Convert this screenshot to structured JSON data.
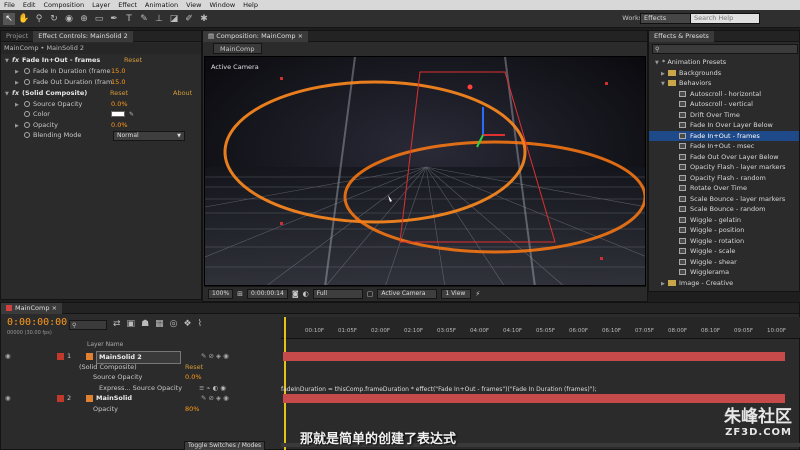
{
  "menu": [
    "File",
    "Edit",
    "Composition",
    "Layer",
    "Effect",
    "Animation",
    "View",
    "Window",
    "Help"
  ],
  "toolbar": {
    "workspace_label": "Workspace:",
    "workspace_value": "Effects",
    "search_placeholder": "Search Help"
  },
  "left_panel": {
    "tabs": [
      "Project",
      "Effect Controls: MainSolid 2"
    ],
    "breadcrumb": "MainComp • MainSolid 2",
    "effect1": {
      "name": "Fade In+Out - frames",
      "reset": "Reset"
    },
    "props1": [
      {
        "label": "Fade In Duration (frame",
        "value": "15.0"
      },
      {
        "label": "Fade Out Duration (fram",
        "value": "15.0"
      }
    ],
    "effect2": {
      "name": "(Solid Composite)",
      "reset": "Reset",
      "about": "About"
    },
    "props2": [
      {
        "label": "Source Opacity",
        "value": "0.0%"
      },
      {
        "label": "Color",
        "value": ""
      },
      {
        "label": "Opacity",
        "value": "0.0%"
      },
      {
        "label": "Blending Mode",
        "value": "Normal"
      }
    ]
  },
  "comp": {
    "tab": "Composition: MainComp",
    "subtab": "MainComp",
    "camera_label": "Active Camera",
    "zoom": "100%",
    "timecode": "0:00:00:14",
    "resolution": "Full",
    "view": "Active Camera",
    "views": "1 View"
  },
  "right_panel": {
    "tab": "Effects & Presets",
    "items": [
      {
        "label": "* Animation Presets",
        "kind": "root"
      },
      {
        "label": "Backgrounds",
        "kind": "folder"
      },
      {
        "label": "Behaviors",
        "kind": "folder-open"
      },
      {
        "label": "Autoscroll - horizontal",
        "kind": "preset"
      },
      {
        "label": "Autoscroll - vertical",
        "kind": "preset"
      },
      {
        "label": "Drift Over Time",
        "kind": "preset"
      },
      {
        "label": "Fade In Over Layer Below",
        "kind": "preset"
      },
      {
        "label": "Fade In+Out - frames",
        "kind": "preset-selected"
      },
      {
        "label": "Fade In+Out - msec",
        "kind": "preset"
      },
      {
        "label": "Fade Out Over Layer Below",
        "kind": "preset"
      },
      {
        "label": "Opacity Flash - layer markers",
        "kind": "preset"
      },
      {
        "label": "Opacity Flash - random",
        "kind": "preset"
      },
      {
        "label": "Rotate Over Time",
        "kind": "preset"
      },
      {
        "label": "Scale Bounce - layer markers",
        "kind": "preset"
      },
      {
        "label": "Scale Bounce - random",
        "kind": "preset"
      },
      {
        "label": "Wiggle - gelatin",
        "kind": "preset"
      },
      {
        "label": "Wiggle - position",
        "kind": "preset"
      },
      {
        "label": "Wiggle - rotation",
        "kind": "preset"
      },
      {
        "label": "Wiggle - scale",
        "kind": "preset"
      },
      {
        "label": "Wiggle - shear",
        "kind": "preset"
      },
      {
        "label": "Wigglerama",
        "kind": "preset"
      },
      {
        "label": "Image - Creative",
        "kind": "folder"
      }
    ]
  },
  "timeline": {
    "tab": "MainComp",
    "timecode": "0:00:00:00",
    "fps": "00000 (30.00 fps)",
    "column_header": "Layer Name",
    "ruler": [
      "00:10F",
      "01:05F",
      "02:00F",
      "02:10F",
      "03:05F",
      "04:00F",
      "04:10F",
      "05:05F",
      "06:00F",
      "06:10F",
      "07:05F",
      "08:00F",
      "08:10F",
      "09:05F",
      "10:00F"
    ],
    "rows": [
      {
        "num": "1",
        "name": "MainSolid 2",
        "type": "layer",
        "color": "#e08030"
      },
      {
        "num": "",
        "name": "(Solid Composite)",
        "type": "effect",
        "link": "Reset"
      },
      {
        "num": "",
        "name": "Source Opacity",
        "type": "prop",
        "value": "0.0%"
      },
      {
        "num": "",
        "name": "Express... Source Opacity",
        "type": "expr"
      },
      {
        "num": "2",
        "name": "MainSolid",
        "type": "layer",
        "color": "#e08030"
      },
      {
        "num": "",
        "name": "Opacity",
        "type": "prop",
        "value": "80%"
      }
    ],
    "expression": "fadeInDuration = thisComp.frameDuration * effect(\"Fade In+Out - frames\")(\"Fade In Duration (frames)\");",
    "toggle_label": "Toggle Switches / Modes"
  },
  "subtitle": "那就是简单的创建了表达式",
  "watermark": {
    "brand": "朱峰社区",
    "url": "ZF3D.COM"
  },
  "colors": {
    "accent": "#ff9a1a",
    "selection": "#1e4a8a",
    "track_red": "#c74a4a"
  }
}
